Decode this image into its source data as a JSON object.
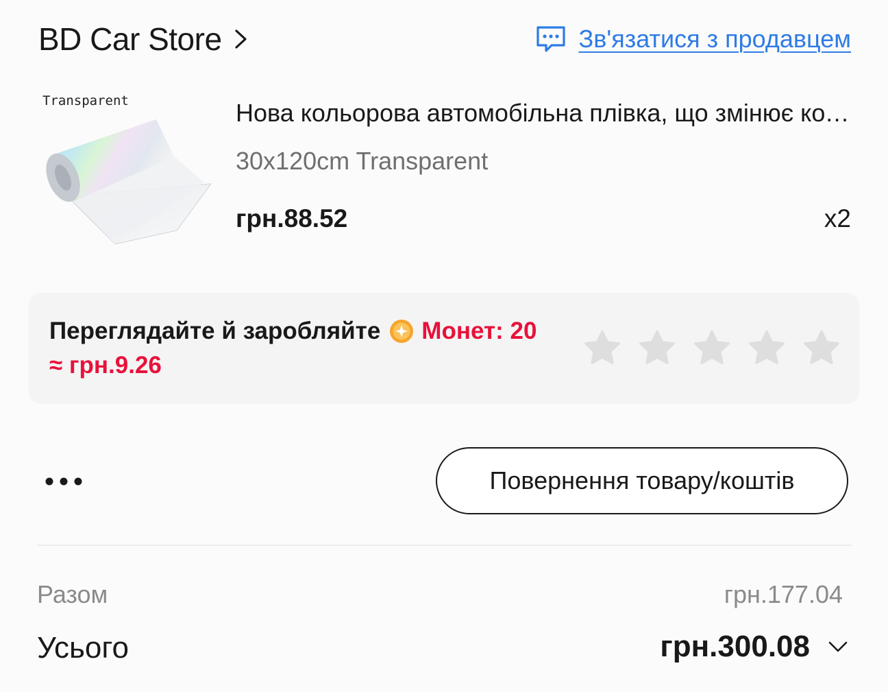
{
  "store": {
    "name": "BD Car Store",
    "contact_label": "Зв'язатися з продавцем"
  },
  "product": {
    "thumb_caption": "Transparent",
    "title": "Нова кольорова автомобільна плівка, що змінює колір, прозора хамелеон наклейка",
    "variant": "30x120cm Transparent",
    "price": "грн.88.52",
    "quantity": "x2"
  },
  "earn": {
    "text": "Переглядайте й заробляйте",
    "coins": "Монет: 20",
    "approx_value": "≈ грн.9.26",
    "stars_total": 5,
    "stars_selected": 0
  },
  "actions": {
    "refund_label": "Повернення товару/коштів"
  },
  "totals": {
    "subtotal_label": "Разом",
    "subtotal_value": "грн.177.04",
    "total_label": "Усього",
    "total_value": "грн.300.08"
  },
  "colors": {
    "accent_link": "#2e7be6",
    "coins_red": "#e8123a",
    "star_gray": "#dedede",
    "coin_orange": "#f5a623"
  },
  "icons": {
    "store_chevron": "chevron-right-icon",
    "contact": "chat-bubble-icon",
    "coin": "coin-icon",
    "star": "star-icon",
    "more": "more-dots-icon",
    "total_expand": "chevron-down-icon"
  }
}
